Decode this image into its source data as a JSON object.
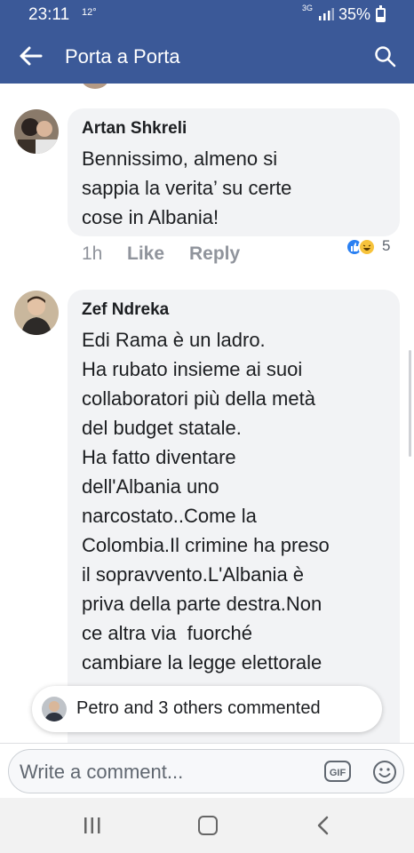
{
  "status_bar": {
    "time": "23:11",
    "temperature": "12°",
    "network": "3G",
    "battery": "35%"
  },
  "app_bar": {
    "title": "Porta a Porta"
  },
  "comments": [
    {
      "author": "Artan Shkreli",
      "lines": [
        "Bennissimo, almeno si",
        "sappia la verita’ su certe",
        "cose in Albania!"
      ],
      "time": "1h",
      "like_label": "Like",
      "reply_label": "Reply",
      "reactions": {
        "icons": [
          "like-icon",
          "haha-icon"
        ],
        "count": "5"
      }
    },
    {
      "author": "Zef Ndreka",
      "lines": [
        "Edi Rama è un ladro.",
        "Ha rubato insieme ai suoi",
        "collaboratori più della metà",
        "del budget statale.",
        "Ha fatto diventare",
        "dell'Albania uno",
        "narcostato..Come la",
        "Colombia.Il crimine ha preso",
        "il sopravvento.L'Albania è",
        "priva della parte destra.Non",
        "ce altra via  fuorché",
        "cambiare la legge elettorale"
      ]
    }
  ],
  "commented_banner": {
    "text": "Petro and 3 others commented"
  },
  "composer": {
    "placeholder": "Write a comment...",
    "gif_label": "GIF"
  },
  "colors": {
    "header": "#3b5998",
    "bubble": "#f2f3f5",
    "meta": "#90949c"
  }
}
